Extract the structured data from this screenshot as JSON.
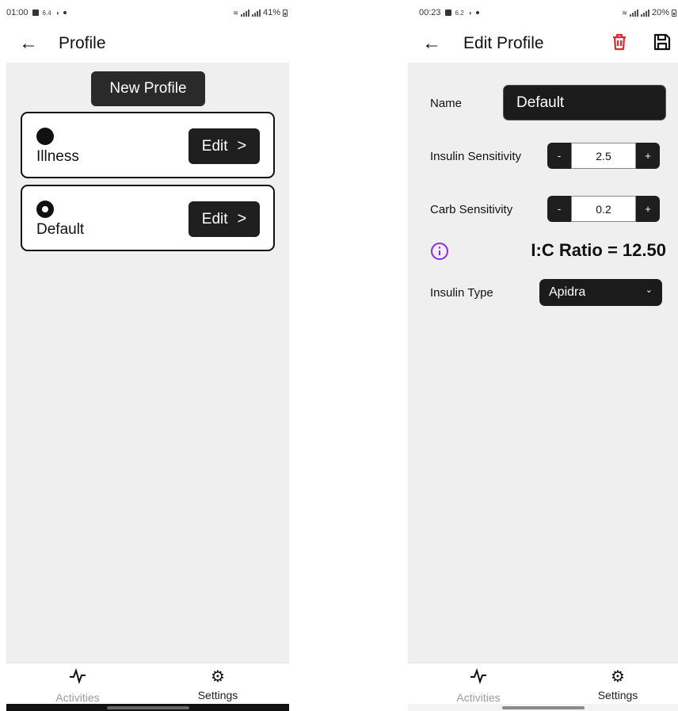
{
  "left": {
    "status": {
      "time": "01:00",
      "extra": "6.4",
      "battery": "41%"
    },
    "title": "Profile",
    "new_profile_label": "New Profile",
    "profiles": [
      {
        "name": "Illness",
        "selected": false,
        "edit_label": "Edit"
      },
      {
        "name": "Default",
        "selected": true,
        "edit_label": "Edit"
      }
    ],
    "nav": [
      {
        "label": "Activities",
        "icon": "activity-pulse-icon"
      },
      {
        "label": "Settings",
        "icon": "gear-icon"
      }
    ]
  },
  "right": {
    "status": {
      "time": "00:23",
      "extra": "6.2",
      "battery": "20%"
    },
    "title": "Edit Profile",
    "icons": {
      "delete": "trash-icon",
      "save": "save-floppy-icon",
      "delete_color": "#e8252a",
      "info_color": "#8a2be2"
    },
    "form": {
      "name_label": "Name",
      "name_value": "Default",
      "insulin_sensitivity_label": "Insulin Sensitivity",
      "insulin_sensitivity_value": "2.5",
      "carb_sensitivity_label": "Carb Sensitivity",
      "carb_sensitivity_value": "0.2",
      "minus_label": "-",
      "plus_label": "+",
      "ratio_text": "I:C Ratio = 12.50",
      "insulin_type_label": "Insulin Type",
      "insulin_type_value": "Apidra"
    },
    "nav": [
      {
        "label": "Activities",
        "icon": "activity-pulse-icon"
      },
      {
        "label": "Settings",
        "icon": "gear-icon"
      }
    ]
  }
}
